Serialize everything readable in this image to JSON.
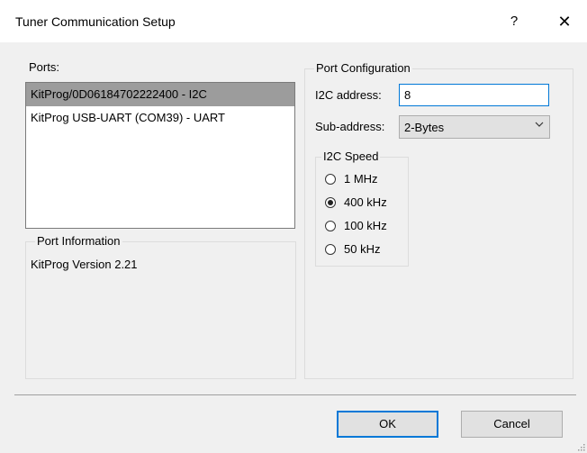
{
  "window": {
    "title": "Tuner Communication Setup",
    "help_glyph": "?",
    "close_glyph": "✕"
  },
  "ports": {
    "label": "Ports:",
    "items": [
      {
        "label": "KitProg/0D06184702222400 - I2C",
        "selected": true
      },
      {
        "label": "KitProg USB-UART (COM39) - UART",
        "selected": false
      }
    ]
  },
  "port_information": {
    "title": "Port Information",
    "text": "KitProg Version 2.21"
  },
  "port_configuration": {
    "title": "Port Configuration",
    "i2c_address_label": "I2C address:",
    "i2c_address_value": "8",
    "sub_address_label": "Sub-address:",
    "sub_address_value": "2-Bytes",
    "i2c_speed": {
      "title": "I2C Speed",
      "options": [
        {
          "label": "1 MHz",
          "checked": false
        },
        {
          "label": "400 kHz",
          "checked": true
        },
        {
          "label": "100 kHz",
          "checked": false
        },
        {
          "label": "50 kHz",
          "checked": false
        }
      ]
    }
  },
  "buttons": {
    "ok": "OK",
    "cancel": "Cancel"
  },
  "colors": {
    "accent": "#0078d7",
    "selection": "#9c9c9c",
    "dialog_bg": "#f0f0f0"
  }
}
